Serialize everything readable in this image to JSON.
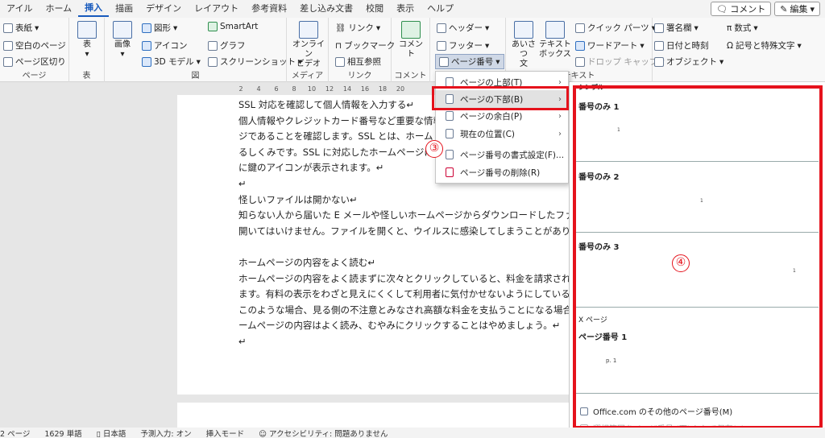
{
  "tabs": [
    "アイル",
    "ホーム",
    "挿入",
    "描画",
    "デザイン",
    "レイアウト",
    "参考資料",
    "差し込み文書",
    "校閲",
    "表示",
    "ヘルプ"
  ],
  "active_tab": "挿入",
  "top_right": {
    "comment": "コメント",
    "edit": "編集"
  },
  "ribbon": {
    "pages": {
      "cover": "表紙",
      "blank": "空白のページ",
      "break": "ページ区切り",
      "label": "ページ"
    },
    "table": {
      "btn": "表",
      "label": "表"
    },
    "illust": {
      "image": "画像",
      "shapes": "図形",
      "icons": "アイコン",
      "3d": "3D モデル",
      "smartart": "SmartArt",
      "chart": "グラフ",
      "screenshot": "スクリーンショット",
      "label": "図"
    },
    "media": {
      "video": "オンライン\nビデオ",
      "label": "メディア"
    },
    "link": {
      "link": "リンク",
      "bookmark": "ブックマーク",
      "crossref": "相互参照",
      "label": "リンク"
    },
    "comment": {
      "btn": "コメント",
      "label": "コメント"
    },
    "hf": {
      "header": "ヘッダー",
      "footer": "フッター",
      "pagenum": "ページ番号"
    },
    "text": {
      "greeting": "あいさつ\n文",
      "textbox": "テキスト\nボックス",
      "quickparts": "クイック パーツ",
      "wordart": "ワードアート",
      "dropcap": "ドロップ キャップ",
      "label": "テキスト"
    },
    "sig": {
      "signature": "署名欄",
      "datetime": "日付と時刻",
      "object": "オブジェクト"
    },
    "sym": {
      "equation": "数式",
      "symbol": "記号と特殊文字",
      "label": "記号と特殊文字"
    }
  },
  "ruler": [
    "2",
    "4",
    "6",
    "8",
    "10",
    "12",
    "14",
    "16",
    "18",
    "20"
  ],
  "doc_lines": [
    "SSL 対応を確認して個人情報を入力する↵",
    "個人情報やクレジットカード番号など重要な情報",
    "ジであることを確認します。SSL とは、ホーム",
    "るしくみです。SSL に対応したホームページは",
    "に鍵のアイコンが表示されます。↵",
    "↵",
    "怪しいファイルは開かない↵",
    "知らない人から届いた E メールや怪しいホームページからダウンロードしたファ",
    "開いてはいけません。ファイルを開くと、ウイルスに感染してしまうことがあり",
    "",
    "ホームページの内容をよく読む↵",
    "ホームページの内容をよく読まずに次々とクリックしていると、料金を請求され",
    "ます。有料の表示をわざと見えにくくして利用者に気付かせないようにしているも",
    "このような場合、見る側の不注意とみなされ高額な料金を支払うことになる場合",
    "ームページの内容はよく読み、むやみにクリックすることはやめましょう。↵",
    "↵"
  ],
  "menu": {
    "items": [
      {
        "label": "ページの上部(T)",
        "arrow": true
      },
      {
        "label": "ページの下部(B)",
        "arrow": true
      },
      {
        "label": "ページの余白(P)",
        "arrow": true
      },
      {
        "label": "現在の位置(C)",
        "arrow": true
      },
      {
        "label": "ページ番号の書式設定(F)...",
        "arrow": false
      },
      {
        "label": "ページ番号の削除(R)",
        "arrow": false
      }
    ]
  },
  "gallery": {
    "header": "シンプル",
    "items": [
      {
        "title": "番号のみ 1",
        "num": "1"
      },
      {
        "title": "番号のみ 2",
        "num": "1"
      },
      {
        "title": "番号のみ 3",
        "num": "1"
      }
    ],
    "section2": "X ページ",
    "item4": {
      "title": "ページ番号 1",
      "num": "p. 1"
    },
    "footer1": "Office.com のその他のページ番号(M)",
    "footer2": "選択範囲をページ番号 (下) として保存(S)"
  },
  "annotations": {
    "step3": "③",
    "step4": "④",
    "accent": "#e5121c"
  },
  "status": {
    "pages": "2 ページ",
    "words": "1629 単語",
    "lang": "日本語",
    "predict": "予測入力: オン",
    "mode": "挿入モード",
    "access": "アクセシビリティ: 問題ありません"
  }
}
